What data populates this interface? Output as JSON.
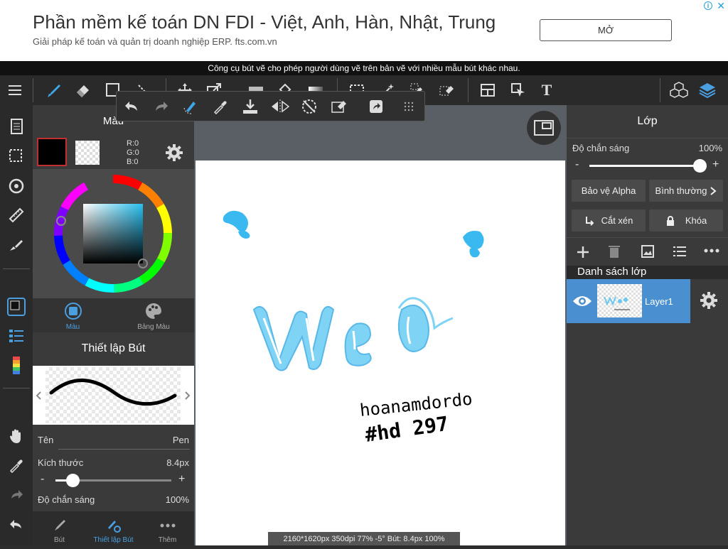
{
  "ad": {
    "title": "Phần mềm kế toán DN FDI - Việt, Anh, Hàn, Nhật, Trung",
    "subtitle": "Giải pháp kế toán và quản trị doanh nghiệp ERP. fts.com.vn",
    "button": "MỞ",
    "info": "i",
    "close": "✕"
  },
  "tooltip": "Công cụ bút vẽ cho phép người dùng vẽ trên bản vẽ với nhiều mẫu bút khác nhau.",
  "toolbar": {
    "text_tool": "T"
  },
  "left_panel": {
    "color_title": "Màu",
    "rgb": {
      "r": "R:0",
      "g": "G:0",
      "b": "B:0"
    },
    "tabs": {
      "color": "Màu",
      "palette": "Bảng Màu"
    },
    "pen_settings_title": "Thiết lập Bút",
    "name_label": "Tên",
    "name_value": "Pen",
    "size_label": "Kích thước",
    "size_value": "8.4px",
    "size_fraction": 0.15,
    "opacity_label": "Độ chắn sáng",
    "opacity_value": "100%",
    "minus": "-",
    "plus": "+",
    "bottom_tabs": {
      "pen": "Bút",
      "pen_settings": "Thiết lập Bút",
      "more": "Thêm"
    }
  },
  "canvas": {
    "status": "2160*1620px 350dpi 77% -5° Bút: 8.4px 100%"
  },
  "right_panel": {
    "title": "Lớp",
    "opacity_label": "Độ chắn sáng",
    "opacity_value": "100%",
    "opacity_fraction": 1.0,
    "minus": "-",
    "plus": "+",
    "alpha_protect": "Bảo vệ Alpha",
    "blend_mode": "Bình thường",
    "clipping": "Cắt xén",
    "lock": "Khóa",
    "layer_list_title": "Danh sách lớp",
    "layer_name": "Layer1"
  },
  "colors": {
    "accent": "#4a90d0",
    "foreground_color": "#000000"
  }
}
